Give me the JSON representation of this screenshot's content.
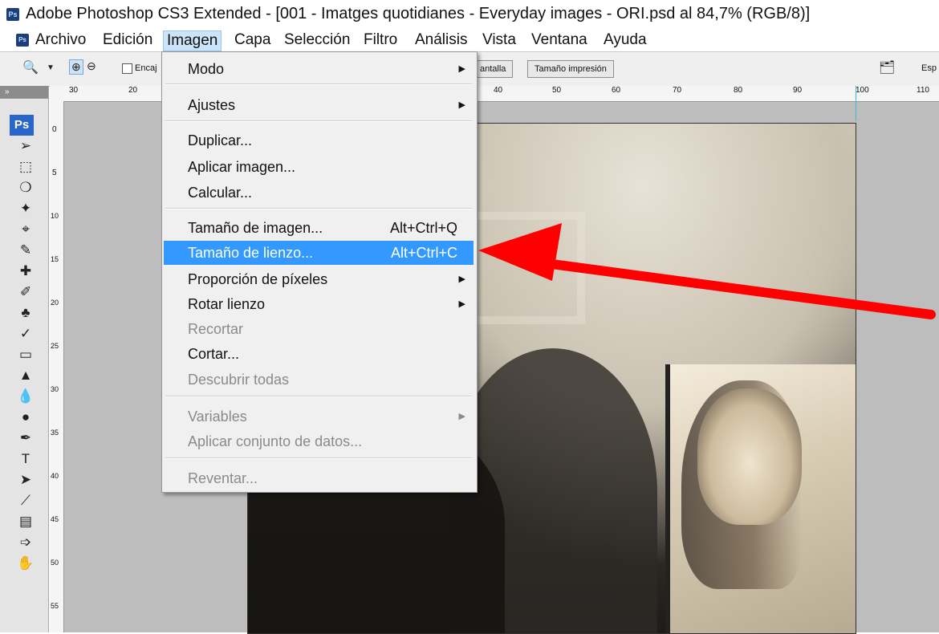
{
  "window": {
    "title": "Adobe Photoshop CS3 Extended - [001 - Imatges quotidianes - Everyday images - ORI.psd al 84,7% (RGB/8)]",
    "app_icon": "Ps"
  },
  "menubar": {
    "items": [
      "Archivo",
      "Edición",
      "Imagen",
      "Capa",
      "Selección",
      "Filtro",
      "Análisis",
      "Vista",
      "Ventana",
      "Ayuda"
    ],
    "active": "Imagen"
  },
  "optionsbar": {
    "checkbox_label": "Encaj",
    "screen_button": "antalla",
    "print_size_button": "Tamaño impresión",
    "right_label": "Esp"
  },
  "ruler": {
    "top_labels": [
      "30",
      "20",
      "40",
      "50",
      "60",
      "70",
      "80",
      "90",
      "100",
      "110"
    ],
    "left_labels": [
      "0",
      "5",
      "10",
      "15",
      "20",
      "25",
      "30",
      "35",
      "40",
      "45",
      "50",
      "55"
    ]
  },
  "toolbox": {
    "header": "»",
    "badge": "Ps",
    "tools": [
      "move-icon",
      "marquee-icon",
      "lasso-icon",
      "magic-wand-icon",
      "crop-icon",
      "slice-icon",
      "healing-icon",
      "brush-icon",
      "stamp-icon",
      "history-brush-icon",
      "eraser-icon",
      "paint-bucket-icon",
      "blur-icon",
      "dodge-icon",
      "pen-icon",
      "type-icon",
      "path-select-icon",
      "line-icon",
      "notes-icon",
      "eyedropper-icon",
      "hand-icon"
    ]
  },
  "image_menu": {
    "items": [
      {
        "label": "Modo",
        "submenu": true,
        "enabled": true
      },
      {
        "label": "Ajustes",
        "submenu": true,
        "enabled": true
      },
      {
        "label": "Duplicar...",
        "enabled": true
      },
      {
        "label": "Aplicar imagen...",
        "enabled": true
      },
      {
        "label": "Calcular...",
        "enabled": true
      },
      {
        "label": "Tamaño de imagen...",
        "shortcut": "Alt+Ctrl+Q",
        "enabled": true
      },
      {
        "label": "Tamaño de lienzo...",
        "shortcut": "Alt+Ctrl+C",
        "enabled": true,
        "highlighted": true
      },
      {
        "label": "Proporción de píxeles",
        "submenu": true,
        "enabled": true
      },
      {
        "label": "Rotar lienzo",
        "submenu": true,
        "enabled": true
      },
      {
        "label": "Recortar",
        "enabled": false
      },
      {
        "label": "Cortar...",
        "enabled": true
      },
      {
        "label": "Descubrir todas",
        "enabled": false
      },
      {
        "label": "Variables",
        "submenu": true,
        "enabled": false
      },
      {
        "label": "Aplicar conjunto de datos...",
        "enabled": false
      },
      {
        "label": "Reventar...",
        "enabled": false
      }
    ]
  },
  "colors": {
    "highlight": "#3399ff",
    "annotation_arrow": "#ff0000"
  }
}
